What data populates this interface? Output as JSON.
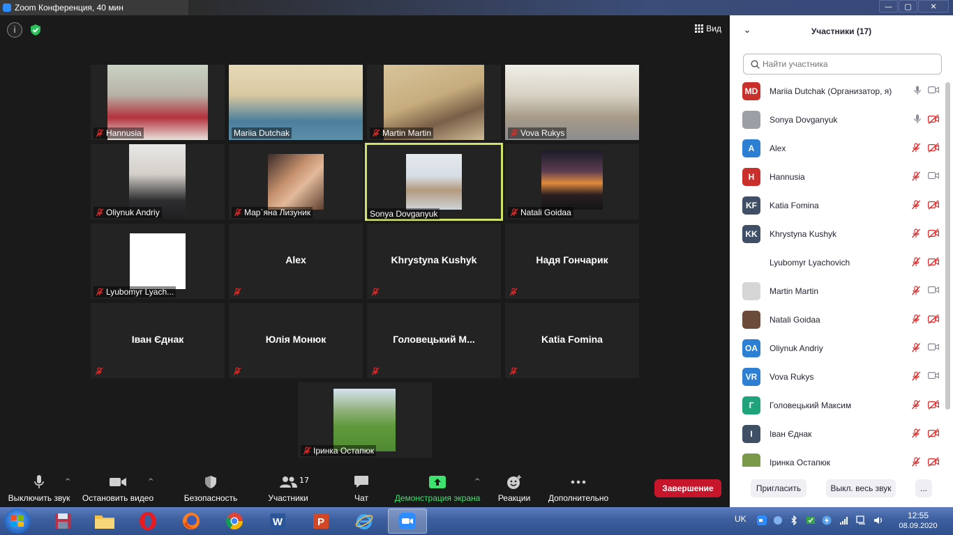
{
  "window": {
    "title": "Zoom Конференция, 40 мин",
    "min_label": "—",
    "max_label": "▢",
    "close_label": "✕"
  },
  "video": {
    "view_label": "Вид",
    "tiles_with_video": [
      {
        "name": "Hannusia",
        "muted": true
      },
      {
        "name": "Mariia Dutchak",
        "muted": false
      },
      {
        "name": "Martin Martin",
        "muted": true
      },
      {
        "name": "Vova Rukys",
        "muted": true
      },
      {
        "name": "Oliynuk Andriy",
        "muted": true
      },
      {
        "name": "Мар`яна Лизуник",
        "muted": true
      },
      {
        "name": "Sonya Dovganyuk",
        "muted": false,
        "active": true
      },
      {
        "name": "Natali Goidaa",
        "muted": true
      },
      {
        "name": "Lyubomyr Lyach...",
        "muted": true
      }
    ],
    "tiles_name_only": [
      {
        "name": "Alex"
      },
      {
        "name": "Khrystyna Kushyk"
      },
      {
        "name": "Надя Гончарик"
      },
      {
        "name": "Іван Єднак"
      },
      {
        "name": "Юлія Монюк"
      },
      {
        "name": "Головецький  М..."
      },
      {
        "name": "Katia Fomina"
      }
    ],
    "last_tile": {
      "name": "Іринка Остапюк",
      "muted": true
    }
  },
  "toolbar": {
    "mute": "Выключить звук",
    "stop_video": "Остановить видео",
    "security": "Безопасность",
    "participants": "Участники",
    "participants_count": "17",
    "chat": "Чат",
    "share": "Демонстрация экрана",
    "reactions": "Реакции",
    "more": "Дополнительно",
    "end": "Завершение"
  },
  "panel": {
    "title": "Участники (17)",
    "search_placeholder": "Найти участника",
    "participants": [
      {
        "initials": "MD",
        "color": "#c9302c",
        "name": "Mariia Dutchak (Организатор, я)",
        "mic": "on",
        "cam": "on"
      },
      {
        "initials": "",
        "color": "#9aa0a6",
        "name": "Sonya Dovganyuk",
        "mic": "on",
        "cam": "off"
      },
      {
        "initials": "A",
        "color": "#2d7fd3",
        "name": "Alex",
        "mic": "off",
        "cam": "off"
      },
      {
        "initials": "H",
        "color": "#c9302c",
        "name": "Hannusia",
        "mic": "off",
        "cam": "on"
      },
      {
        "initials": "KF",
        "color": "#3e4f66",
        "name": "Katia Fomina",
        "mic": "off",
        "cam": "off"
      },
      {
        "initials": "KK",
        "color": "#3e4f66",
        "name": "Khrystyna Kushyk",
        "mic": "off",
        "cam": "off"
      },
      {
        "initials": "",
        "color": "#ffffff",
        "name": "Lyubomyr Lyachovich",
        "mic": "off",
        "cam": "off"
      },
      {
        "initials": "",
        "color": "#d6d6d6",
        "name": "Martin Martin",
        "mic": "off",
        "cam": "on"
      },
      {
        "initials": "",
        "color": "#6b4b3a",
        "name": "Natali Goidaa",
        "mic": "off",
        "cam": "off"
      },
      {
        "initials": "OA",
        "color": "#2d7fd3",
        "name": "Oliynuk Andriy",
        "mic": "off",
        "cam": "on"
      },
      {
        "initials": "VR",
        "color": "#2d7fd3",
        "name": "Vova Rukys",
        "mic": "off",
        "cam": "on"
      },
      {
        "initials": "Г",
        "color": "#1fa37a",
        "name": "Головецький Максим",
        "mic": "off",
        "cam": "off"
      },
      {
        "initials": "I",
        "color": "#3e4f66",
        "name": "Іван Єднак",
        "mic": "off",
        "cam": "off"
      },
      {
        "initials": "",
        "color": "#7a9a4a",
        "name": "Іринка Остапюк",
        "mic": "off",
        "cam": "off"
      }
    ],
    "invite": "Пригласить",
    "mute_all": "Выкл. весь звук",
    "more": "..."
  },
  "taskbar": {
    "lang": "UK",
    "time": "12:55",
    "date": "08.09.2020"
  },
  "colors": {
    "accent": "#2d8cff",
    "end": "#c7162b",
    "active_border": "#cfe36a",
    "share_green": "#3ee26f",
    "mute_red": "#e02828"
  }
}
